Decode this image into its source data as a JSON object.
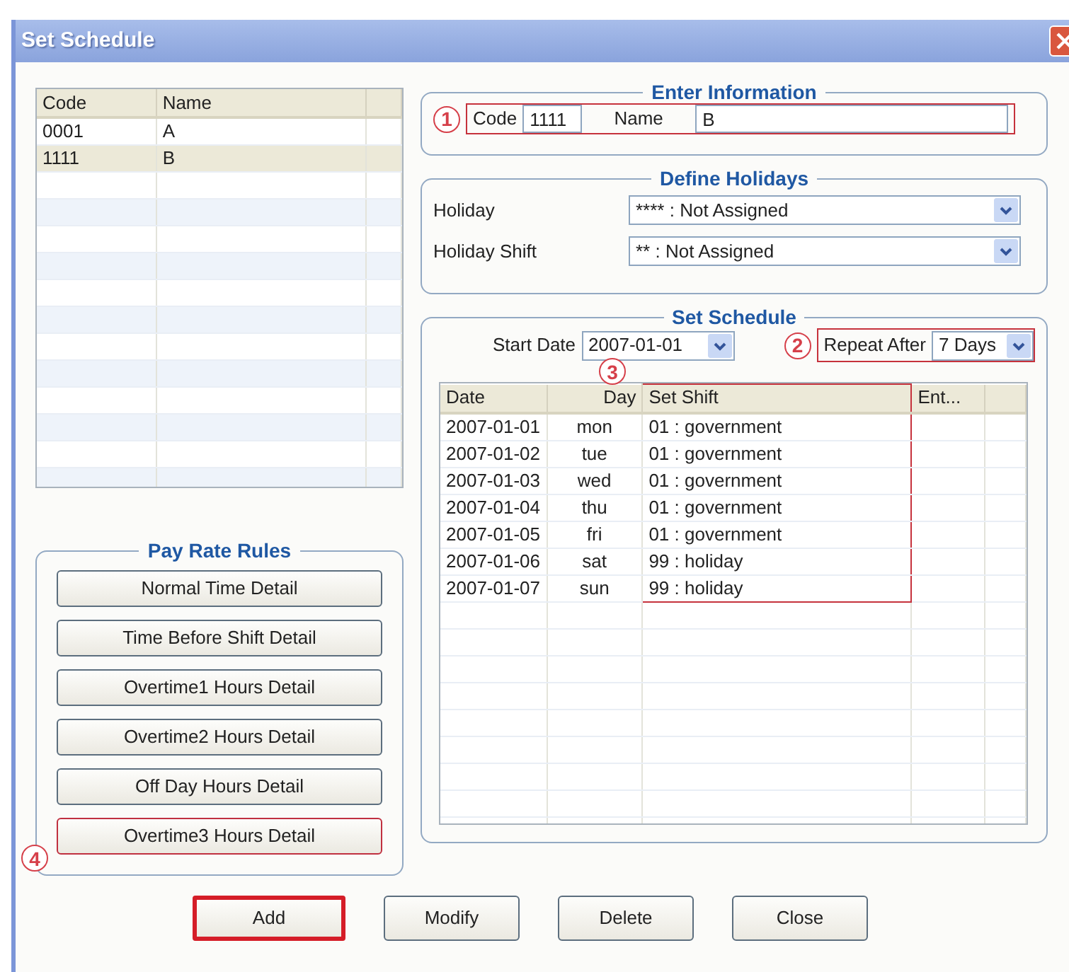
{
  "window": {
    "title": "Set Schedule"
  },
  "list": {
    "columns": [
      "Code",
      "Name"
    ],
    "rows": [
      {
        "code": "0001",
        "name": "A",
        "selected": false
      },
      {
        "code": "1111",
        "name": "B",
        "selected": true
      }
    ]
  },
  "pay_rate_rules": {
    "title": "Pay Rate Rules",
    "buttons": [
      {
        "label": "Normal Time Detail",
        "highlighted": false
      },
      {
        "label": "Time Before Shift Detail",
        "highlighted": false
      },
      {
        "label": "Overtime1 Hours Detail",
        "highlighted": false
      },
      {
        "label": "Overtime2 Hours Detail",
        "highlighted": false
      },
      {
        "label": "Off Day Hours Detail",
        "highlighted": false
      },
      {
        "label": "Overtime3 Hours Detail",
        "highlighted": true,
        "callout": "4"
      }
    ]
  },
  "enter_information": {
    "title": "Enter Information",
    "callout": "1",
    "highlighted": true,
    "code_label": "Code",
    "code_value": "1111",
    "name_label": "Name",
    "name_value": "B"
  },
  "define_holidays": {
    "title": "Define Holidays",
    "rows": [
      {
        "label": "Holiday",
        "value": "**** : Not Assigned"
      },
      {
        "label": "Holiday Shift",
        "value": "** : Not Assigned"
      }
    ]
  },
  "set_schedule": {
    "title": "Set Schedule",
    "start_date_label": "Start Date",
    "start_date": "2007-01-01",
    "repeat": {
      "callout": "2",
      "highlighted": true,
      "label": "Repeat After",
      "value": "7 Days"
    },
    "table": {
      "columns": [
        {
          "label": "Date",
          "highlighted": false
        },
        {
          "label": "Day",
          "highlighted": false
        },
        {
          "label": "Set Shift",
          "highlighted": true,
          "callout": "3"
        },
        {
          "label": "Ent...",
          "highlighted": false
        }
      ],
      "rows": [
        {
          "date": "2007-01-01",
          "day": "mon",
          "shift": "01 : government"
        },
        {
          "date": "2007-01-02",
          "day": "tue",
          "shift": "01 : government"
        },
        {
          "date": "2007-01-03",
          "day": "wed",
          "shift": "01 : government"
        },
        {
          "date": "2007-01-04",
          "day": "thu",
          "shift": "01 : government"
        },
        {
          "date": "2007-01-05",
          "day": "fri",
          "shift": "01 : government"
        },
        {
          "date": "2007-01-06",
          "day": "sat",
          "shift": "99 : holiday"
        },
        {
          "date": "2007-01-07",
          "day": "sun",
          "shift": "99 : holiday"
        }
      ]
    }
  },
  "buttons": [
    {
      "label": "Add",
      "highlighted": true
    },
    {
      "label": "Modify",
      "highlighted": false
    },
    {
      "label": "Delete",
      "highlighted": false
    },
    {
      "label": "Close",
      "highlighted": false
    }
  ]
}
